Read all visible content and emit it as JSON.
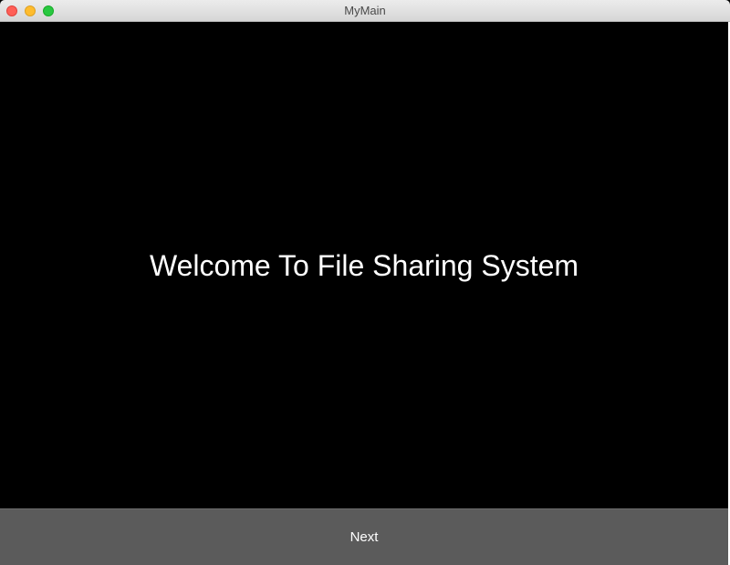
{
  "window": {
    "title": "MyMain"
  },
  "main": {
    "welcome_text": "Welcome To File Sharing System"
  },
  "footer": {
    "next_label": "Next"
  },
  "colors": {
    "background": "#000000",
    "footer_bar": "#5b5b5b",
    "text": "#ffffff"
  }
}
